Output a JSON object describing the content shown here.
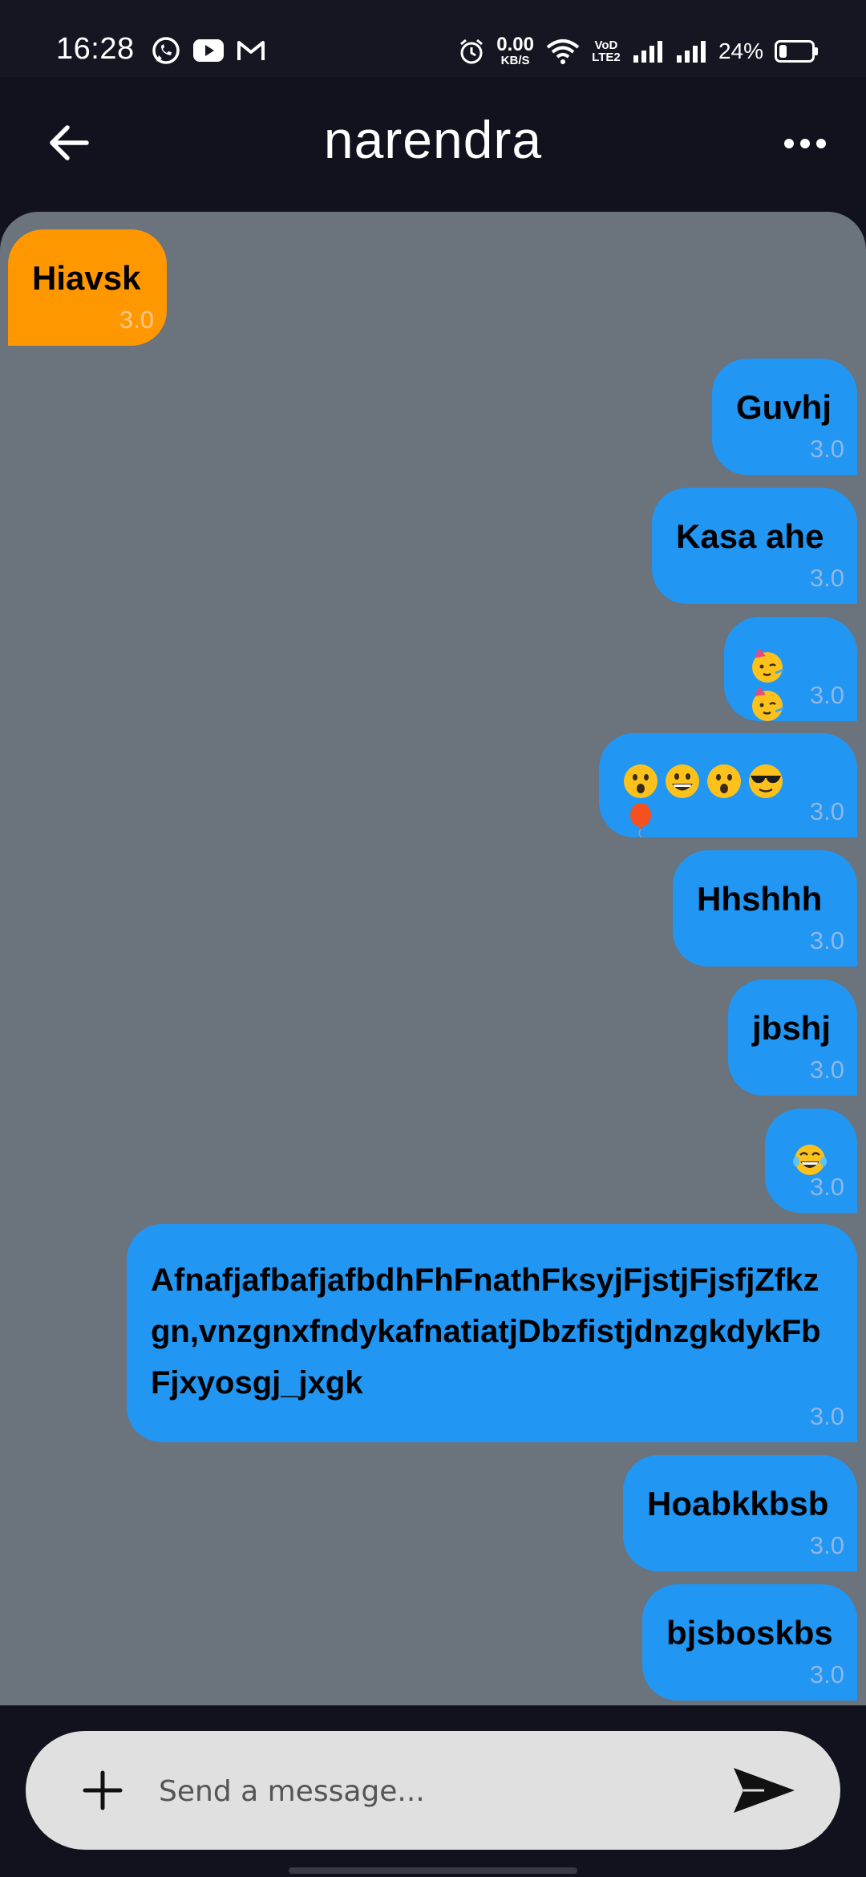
{
  "status_bar": {
    "time": "16:28",
    "app_icons": [
      "whatsapp-icon",
      "youtube-icon",
      "gmail-icon"
    ],
    "net_speed_value": "0.00",
    "net_speed_unit": "KB/S",
    "volte_line1": "VoD",
    "volte_line2": "LTE2",
    "battery_percent": "24%",
    "battery_level": 0.24
  },
  "header": {
    "title": "narendra",
    "back_icon": "arrow-left-icon",
    "more_icon": "more-horizontal-icon"
  },
  "messages": [
    {
      "side": "in",
      "text": "Hiavsk",
      "time": "3.0"
    },
    {
      "side": "out",
      "text": "Guvhj",
      "time": "3.0"
    },
    {
      "side": "out",
      "text": "Kasa ahe",
      "time": "3.0"
    },
    {
      "side": "out",
      "emojis": [
        "partying-face-emoji",
        "partying-face-emoji"
      ],
      "time": "3.0"
    },
    {
      "side": "out",
      "emojis": [
        "astonished-face-emoji",
        "grinning-face-emoji",
        "astonished-face-emoji",
        "sunglasses-face-emoji",
        "balloon-emoji"
      ],
      "time": "3.0"
    },
    {
      "side": "out",
      "text": "Hhshhh",
      "time": "3.0"
    },
    {
      "side": "out",
      "text": "jbshj",
      "time": "3.0"
    },
    {
      "side": "out",
      "emojis": [
        "tears-of-joy-emoji"
      ],
      "time": "3.0"
    },
    {
      "side": "out",
      "text": "AfnafjafbafjafbdhFhFnathFksyjFjstjFjsfjZfkzgn,vnzgnxfndykafnatiatjDbzfistjdnzgkdykFbFjxyosgj_jxgk",
      "time": "3.0"
    },
    {
      "side": "out",
      "text": "Hoabkkbsb",
      "time": "3.0"
    },
    {
      "side": "out",
      "text": "bjsboskbs",
      "time": "3.0"
    }
  ],
  "composer": {
    "placeholder": "Send a message...",
    "value": "",
    "add_icon": "plus-icon",
    "send_icon": "send-icon"
  },
  "colors": {
    "background": "#12121e",
    "chat_background": "#6b737c",
    "incoming_bubble": "#ff9800",
    "outgoing_bubble": "#2196f3",
    "composer": "#e0e0e0"
  }
}
